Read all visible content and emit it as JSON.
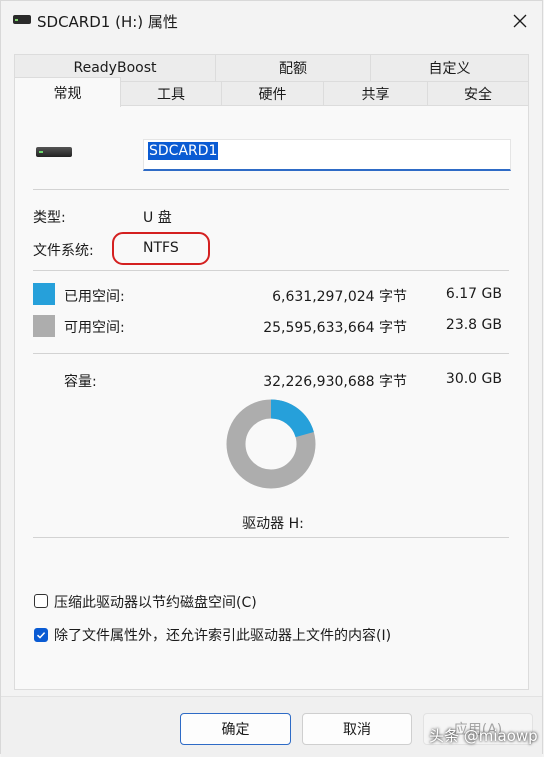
{
  "window": {
    "title": "SDCARD1 (H:) 属性",
    "close_icon": "close-icon"
  },
  "tabs_row1": [
    {
      "label": "ReadyBoost"
    },
    {
      "label": "配额"
    },
    {
      "label": "自定义"
    }
  ],
  "tabs_row2": [
    {
      "label": "常规",
      "active": true
    },
    {
      "label": "工具"
    },
    {
      "label": "硬件"
    },
    {
      "label": "共享"
    },
    {
      "label": "安全"
    }
  ],
  "general": {
    "drive_name": "SDCARD1",
    "type_label": "类型:",
    "type_value": "U 盘",
    "fs_label": "文件系统:",
    "fs_value": "NTFS",
    "used_label": "已用空间:",
    "used_bytes": "6,631,297,024 字节",
    "used_size": "6.17 GB",
    "free_label": "可用空间:",
    "free_bytes": "25,595,633,664 字节",
    "free_size": "23.8 GB",
    "capacity_label": "容量:",
    "capacity_bytes": "32,226,930,688 字节",
    "capacity_size": "30.0 GB",
    "drive_label": "驱动器 H:",
    "used_fraction": 0.2058,
    "used_color": "#26a0da",
    "free_color": "#adadad",
    "compress_label": "压缩此驱动器以节约磁盘空间(C)",
    "compress_checked": false,
    "index_label": "除了文件属性外，还允许索引此驱动器上文件的内容(I)",
    "index_checked": true
  },
  "buttons": {
    "ok": "确定",
    "cancel": "取消",
    "apply": "应用(A)"
  },
  "watermark": "头条 @miaowp"
}
